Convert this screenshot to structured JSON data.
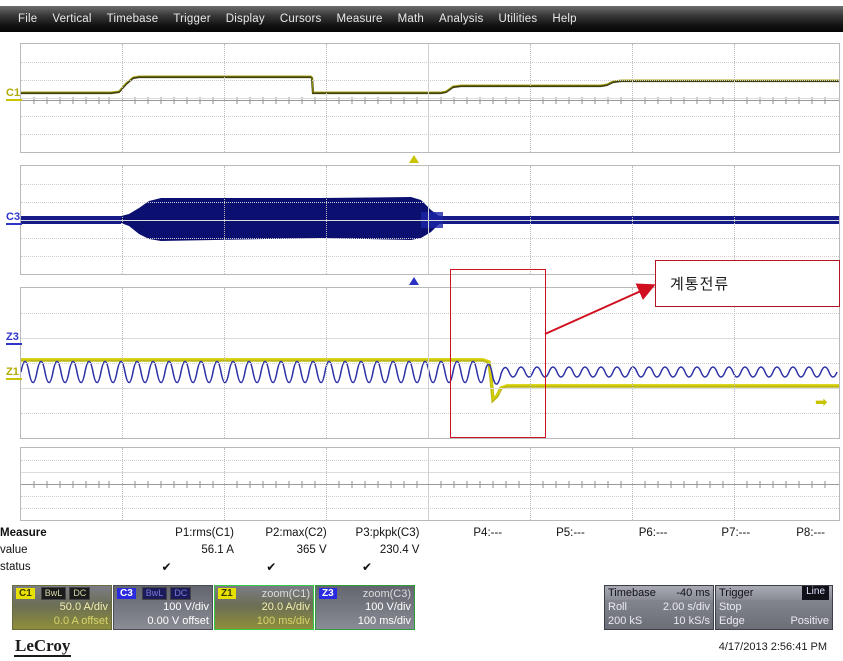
{
  "menu": {
    "items": [
      {
        "label": "File"
      },
      {
        "label": "Vertical"
      },
      {
        "label": "Timebase"
      },
      {
        "label": "Trigger"
      },
      {
        "label": "Display"
      },
      {
        "label": "Cursors"
      },
      {
        "label": "Measure"
      },
      {
        "label": "Math"
      },
      {
        "label": "Analysis"
      },
      {
        "label": "Utilities"
      },
      {
        "label": "Help"
      }
    ]
  },
  "grid": {
    "channel_labels": [
      {
        "name": "C1",
        "color": "#c9c400"
      },
      {
        "name": "C3",
        "color": "#2f35c8"
      },
      {
        "name": "Z3",
        "color": "#2f35c8"
      },
      {
        "name": "Z1",
        "color": "#c9c400"
      }
    ],
    "markers": {
      "trigger_level_color": "#c9c400",
      "zoom_marker_color": "#2b31c4",
      "right_arrow": "➡",
      "right_arrow_color": "#c9c400"
    }
  },
  "annotation": {
    "text": "계통전류",
    "box_color": "#b11422",
    "arrow_color": "#d01020"
  },
  "measure": {
    "row_labels": [
      "Measure",
      "value",
      "status"
    ],
    "columns": [
      {
        "header": "P1:rms(C1)",
        "value": "56.1 A",
        "status": "✔"
      },
      {
        "header": "P2:max(C2)",
        "value": "365 V",
        "status": "✔"
      },
      {
        "header": "P3:pkpk(C3)",
        "value": "230.4 V",
        "status": "✔"
      },
      {
        "header": "P4:---",
        "value": "",
        "status": ""
      },
      {
        "header": "P5:---",
        "value": "",
        "status": ""
      },
      {
        "header": "P6:---",
        "value": "",
        "status": ""
      },
      {
        "header": "P7:---",
        "value": "",
        "status": ""
      },
      {
        "header": "P8:---",
        "value": "",
        "status": ""
      }
    ]
  },
  "descriptors": [
    {
      "tag": "C1",
      "tag_color": "#e8e000",
      "badges": [
        "BwL",
        "DC"
      ],
      "title": "",
      "line1": "50.0 A/div",
      "line2": "0.0 A offset",
      "text_color": "#e8e45a"
    },
    {
      "tag": "C3",
      "tag_color": "#2a2ae0",
      "badges": [
        "BwL",
        "DC"
      ],
      "title": "",
      "line1": "100 V/div",
      "line2": "0.00 V offset",
      "text_color": "#ffffff"
    },
    {
      "tag": "Z1",
      "tag_color": "#e8e000",
      "badges": [],
      "title": "zoom(C1)",
      "line1": "20.0 A/div",
      "line2": "100 ms/div",
      "text_color": "#e8e45a"
    },
    {
      "tag": "Z3",
      "tag_color": "#2a2ae0",
      "badges": [],
      "title": "zoom(C3)",
      "line1": "100 V/div",
      "line2": "100 ms/div",
      "text_color": "#ffffff"
    }
  ],
  "timebase_panel": {
    "title": "Timebase",
    "delay": "-40 ms",
    "mode": "Roll",
    "scale": "2.00 s/div",
    "memory": "200 kS",
    "rate": "10 kS/s"
  },
  "trigger_panel": {
    "title": "Trigger",
    "source": "Line",
    "state": "Stop",
    "type": "Edge",
    "slope": "Positive"
  },
  "footer": {
    "brand": "LeCroy",
    "timestamp": "4/17/2013 2:56:41 PM"
  }
}
